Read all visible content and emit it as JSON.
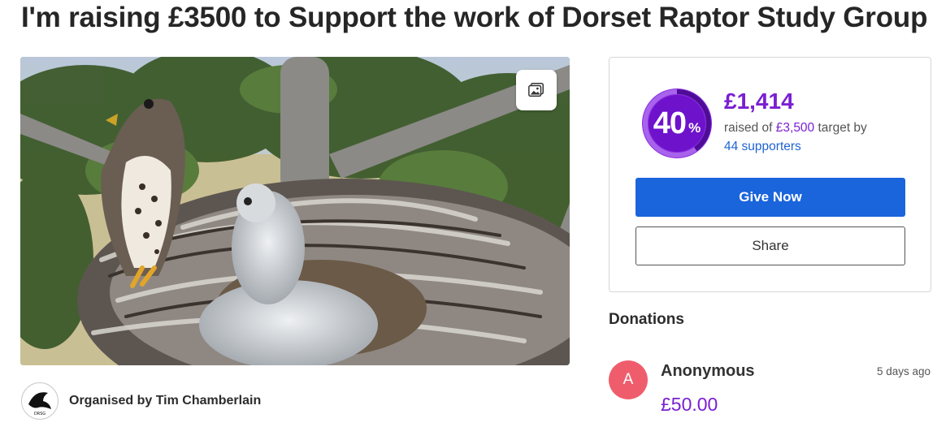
{
  "page": {
    "title": "I'm raising £3500 to Support the work of Dorset Raptor Study Group"
  },
  "hero": {
    "gallery_icon": "image-gallery-icon"
  },
  "organiser": {
    "logo_text": "DRSG",
    "label": "Organised by Tim Chamberlain"
  },
  "fundraiser": {
    "percent": "40",
    "percent_sign": "%",
    "progress_fraction": 0.4,
    "raised": "£1,414",
    "raised_of_prefix": "raised of ",
    "target": "£3,500",
    "target_suffix": " target by",
    "supporters": "44 supporters",
    "give_label": "Give Now",
    "share_label": "Share",
    "colors": {
      "accent": "#7a1fd1",
      "primary_button": "#1a64dc",
      "link": "#1f63d1"
    }
  },
  "donations": {
    "heading": "Donations",
    "items": [
      {
        "initial": "A",
        "name": "Anonymous",
        "time": "5 days ago",
        "amount": "£50.00",
        "avatar_color": "#ef5d6d"
      }
    ]
  }
}
